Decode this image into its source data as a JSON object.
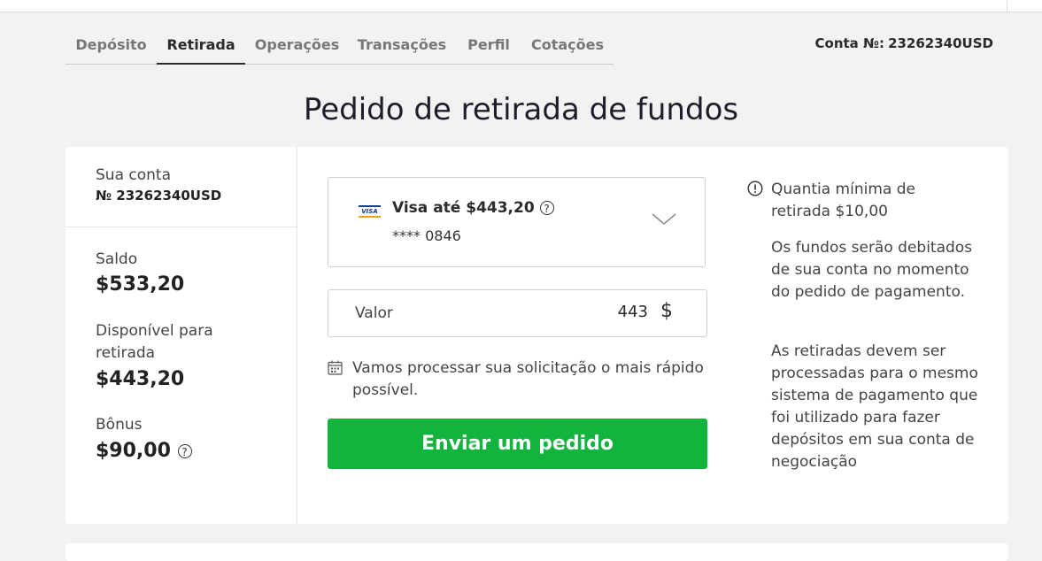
{
  "tabs": [
    {
      "label": "Depósito"
    },
    {
      "label": "Retirada"
    },
    {
      "label": "Operações"
    },
    {
      "label": "Transações"
    },
    {
      "label": "Perfil"
    },
    {
      "label": "Cotações"
    }
  ],
  "header": {
    "account_label": "Conta №:",
    "account_number": "23262340USD"
  },
  "page_title": "Pedido de retirada de fundos",
  "account_panel": {
    "label": "Sua conta",
    "number": "№ 23262340USD",
    "balance_label": "Saldo",
    "balance_value": "$533,20",
    "available_label": "Disponível para retirada",
    "available_value": "$443,20",
    "bonus_label": "Bônus",
    "bonus_value": "$90,00"
  },
  "payment_method": {
    "logo_text": "VISA",
    "name": "Visa até $443,20",
    "card_mask": "**** 0846",
    "icon": "chevron-down-icon"
  },
  "amount": {
    "label": "Valor",
    "value": "443",
    "currency": "$"
  },
  "processing_note": "Vamos processar sua solicitação o mais rápido possível.",
  "submit_label": "Enviar um pedido",
  "info": {
    "min_amount": "Quantia mínima de retirada $10,00",
    "debit_note": "Os fundos serão debitados de sua conta no momento do pedido de pagamento.",
    "same_system_note": "As retiradas devem ser processadas para o mesmo sistema de pagamento que foi utilizado para fazer depósitos em sua conta de negociação"
  },
  "colors": {
    "accent_green": "#12b43e",
    "background": "#f2f2f2"
  }
}
